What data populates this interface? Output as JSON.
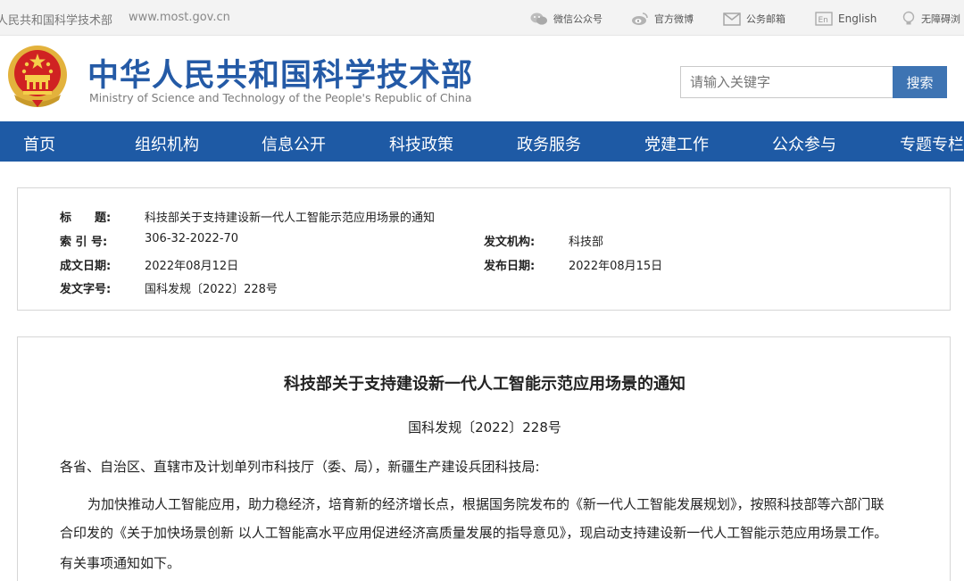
{
  "topbar": {
    "site_name": "人民共和国科学技术部",
    "url": "www.most.gov.cn",
    "links": {
      "wechat": "微信公众号",
      "weibo": "官方微博",
      "mail": "公务邮箱",
      "english": "English",
      "accessibility": "无障碍浏"
    }
  },
  "header": {
    "title_cn": "中华人民共和国科学技术部",
    "title_en": "Ministry of Science and Technology of the People's Republic of China",
    "search_placeholder": "请输入关键字",
    "search_button": "搜索"
  },
  "nav": [
    "首页",
    "组织机构",
    "信息公开",
    "科技政策",
    "政务服务",
    "党建工作",
    "公众参与",
    "专题专栏"
  ],
  "info": {
    "title_label": "标　　题:",
    "title_value": "科技部关于支持建设新一代人工智能示范应用场景的通知",
    "index_label": "索 引 号:",
    "index_value": "306-32-2022-70",
    "issuer_label": "发文机构:",
    "issuer_value": "科技部",
    "created_label": "成文日期:",
    "created_value": "2022年08月12日",
    "published_label": "发布日期:",
    "published_value": "2022年08月15日",
    "docno_label": "发文字号:",
    "docno_value": "国科发规〔2022〕228号"
  },
  "article": {
    "title": "科技部关于支持建设新一代人工智能示范应用场景的通知",
    "doc_number": "国科发规〔2022〕228号",
    "salutation": "各省、自治区、直辖市及计划单列市科技厅（委、局），新疆生产建设兵团科技局:",
    "para_line1": "为加快推动人工智能应用，助力稳经济，培育新的经济增长点，根据国务院发布的《新一代人工智能发展规划》，按照科技部等六部门联",
    "para_line2": "合印发的《关于加快场景创新 以人工智能高水平应用促进经济高质量发展的指导意见》，现启动支持建设新一代人工智能示范应用场景工作。",
    "para_line3": "有关事项通知如下。"
  },
  "colors": {
    "brand_blue": "#245aa6",
    "nav_blue": "#1e5aa5",
    "button_blue": "#3e74b3"
  }
}
